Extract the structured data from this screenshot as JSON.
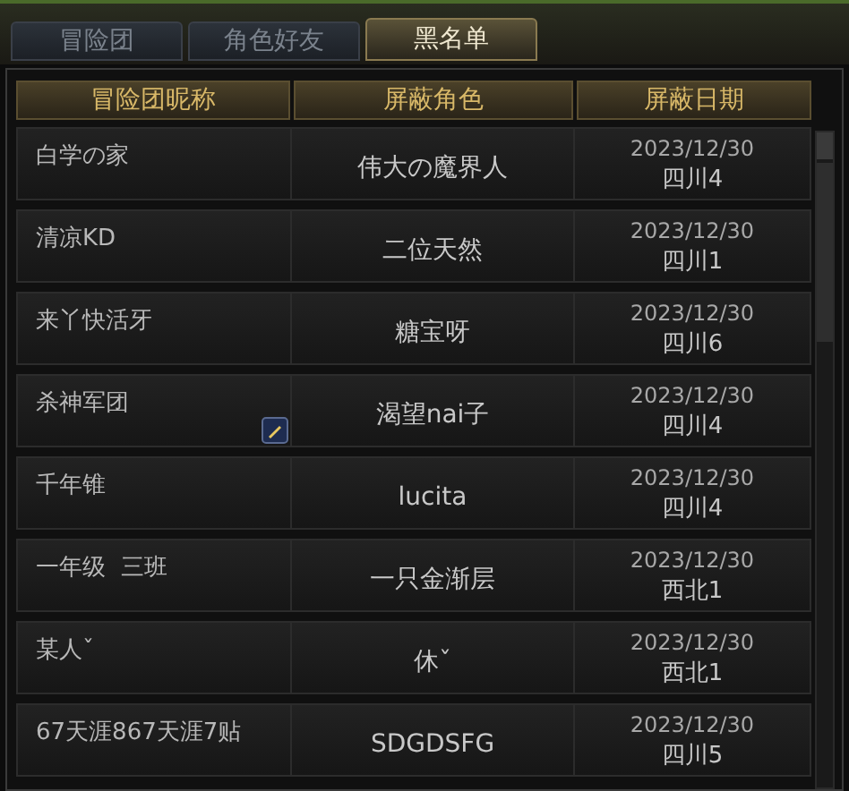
{
  "tabs": [
    {
      "label": "冒险团",
      "selected": false
    },
    {
      "label": "角色好友",
      "selected": false
    },
    {
      "label": "黑名单",
      "selected": true
    }
  ],
  "table": {
    "columns": [
      "冒险团昵称",
      "屏蔽角色",
      "屏蔽日期"
    ],
    "rows": [
      {
        "nickname": "白学の家",
        "character": "伟大の魔界人",
        "date": "2023/12/30",
        "server": "四川4",
        "marked": false
      },
      {
        "nickname": "清凉KD",
        "character": "二位天然",
        "date": "2023/12/30",
        "server": "四川1",
        "marked": false
      },
      {
        "nickname": "来丫快活牙",
        "character": "糖宝呀",
        "date": "2023/12/30",
        "server": "四川6",
        "marked": false
      },
      {
        "nickname": "杀神军团",
        "character": "渴望nai子",
        "date": "2023/12/30",
        "server": "四川4",
        "marked": true
      },
      {
        "nickname": "千年锥",
        "character": "lucita",
        "date": "2023/12/30",
        "server": "四川4",
        "marked": false
      },
      {
        "nickname": "一年级  三班",
        "character": "一只金渐层",
        "date": "2023/12/30",
        "server": "西北1",
        "marked": false
      },
      {
        "nickname": "某人ˇ",
        "character": "休ˇ",
        "date": "2023/12/30",
        "server": "西北1",
        "marked": false
      },
      {
        "nickname": "67天涯867天涯7贴",
        "character": "SDGDSFG",
        "date": "2023/12/30",
        "server": "四川5",
        "marked": false
      }
    ]
  }
}
